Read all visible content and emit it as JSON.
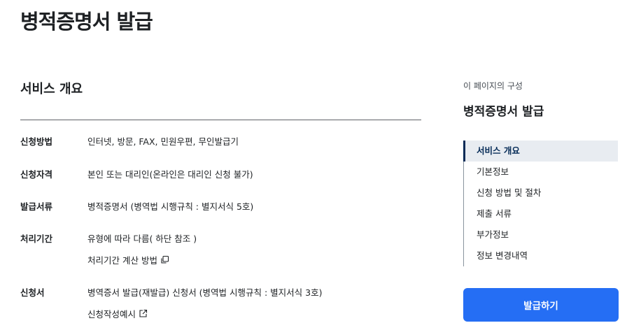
{
  "page": {
    "title": "병적증명서 발급"
  },
  "overview": {
    "heading": "서비스 개요",
    "rows": [
      {
        "label": "신청방법",
        "value": "인터넷, 방문, FAX, 민원우편, 무인발급기"
      },
      {
        "label": "신청자격",
        "value": "본인 또는 대리인(온라인은 대리인 신청 불가)"
      },
      {
        "label": "발급서류",
        "value": "병적증명서 (병역법 시행규칙 : 별지서식 5호)"
      },
      {
        "label": "처리기간",
        "value": "유형에 따라 다름( 하단 참조 )",
        "link": "처리기간 계산 방법",
        "link_icon": "copy-icon"
      },
      {
        "label": "신청서",
        "value": "병역증서 발급(재발급) 신청서 (병역법 시행규칙 : 별지서식 3호)",
        "link": "신청작성예시",
        "link_icon": "external-link-icon"
      }
    ]
  },
  "toc": {
    "caption": "이 페이지의 구성",
    "title": "병적증명서 발급",
    "items": [
      {
        "label": "서비스 개요",
        "active": true
      },
      {
        "label": "기본정보",
        "active": false
      },
      {
        "label": "신청 방법 및 절차",
        "active": false
      },
      {
        "label": "제출 서류",
        "active": false
      },
      {
        "label": "부가정보",
        "active": false
      },
      {
        "label": "정보 변경내역",
        "active": false
      }
    ]
  },
  "actions": {
    "issue_label": "발급하기"
  },
  "colors": {
    "primary": "#256ef4",
    "active_nav": "#052b57",
    "active_nav_bg": "#e8ecf1"
  }
}
